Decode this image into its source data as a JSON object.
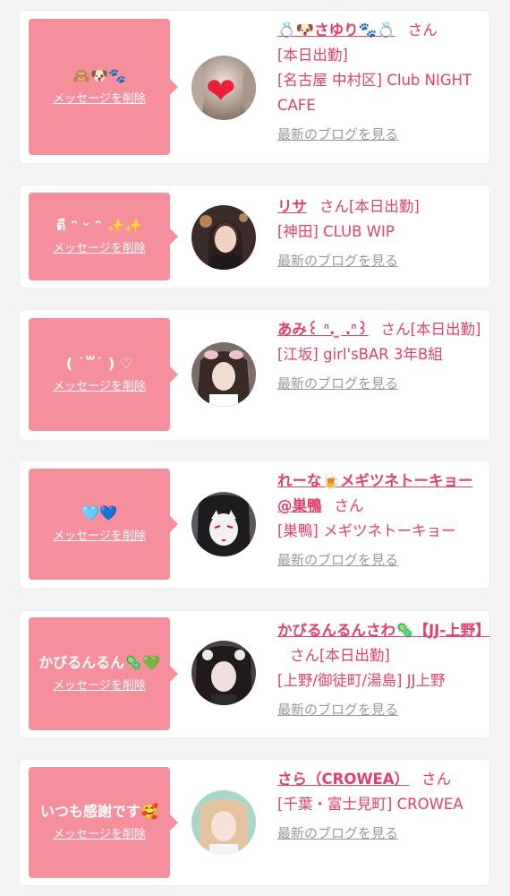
{
  "common": {
    "delete_label": "メッセージを削除",
    "san_label": "さん",
    "blog_label": "最新のブログを見る"
  },
  "cards": [
    {
      "message": "🙈🐶🐾",
      "name": "💍🐶さゆり🐾💍",
      "status": "[本日出勤]",
      "shop": "[名古屋 中村区] Club NIGHT CAFE",
      "avatar_icon": "heart-icon"
    },
    {
      "message": "ดี ᵔ ᵕ ᵔ ✨✨",
      "name": "リサ",
      "status": "[本日出勤]",
      "shop": "[神田] CLUB WIP"
    },
    {
      "message": "( ˙꒳˙ ) ♡",
      "name": "あみ꒰ ᐢ. ̫ .ᐢ꒱",
      "status": "[本日出勤]",
      "shop": "[江坂] girl'sBAR 3年B組"
    },
    {
      "message": "🩵💙",
      "name": "れーな🍺メギツネトーキョー@巣鴨",
      "status": "",
      "shop": "[巣鴨] メギツネトーキョー"
    },
    {
      "message": "かびるんるん🦠💚",
      "name": "かびるんるんさわ🦠【JJ-上野】",
      "status": "[本日出勤]",
      "shop": "[上野/御徒町/湯島] JJ上野"
    },
    {
      "message": "いつも感謝です🥰",
      "name": "さら（CROWEA）",
      "status": "",
      "shop": "[千葉・富士見町] CROWEA"
    }
  ],
  "colors": {
    "bubble": "#f68f9c",
    "accent": "#e0406a",
    "muted": "#999999"
  }
}
